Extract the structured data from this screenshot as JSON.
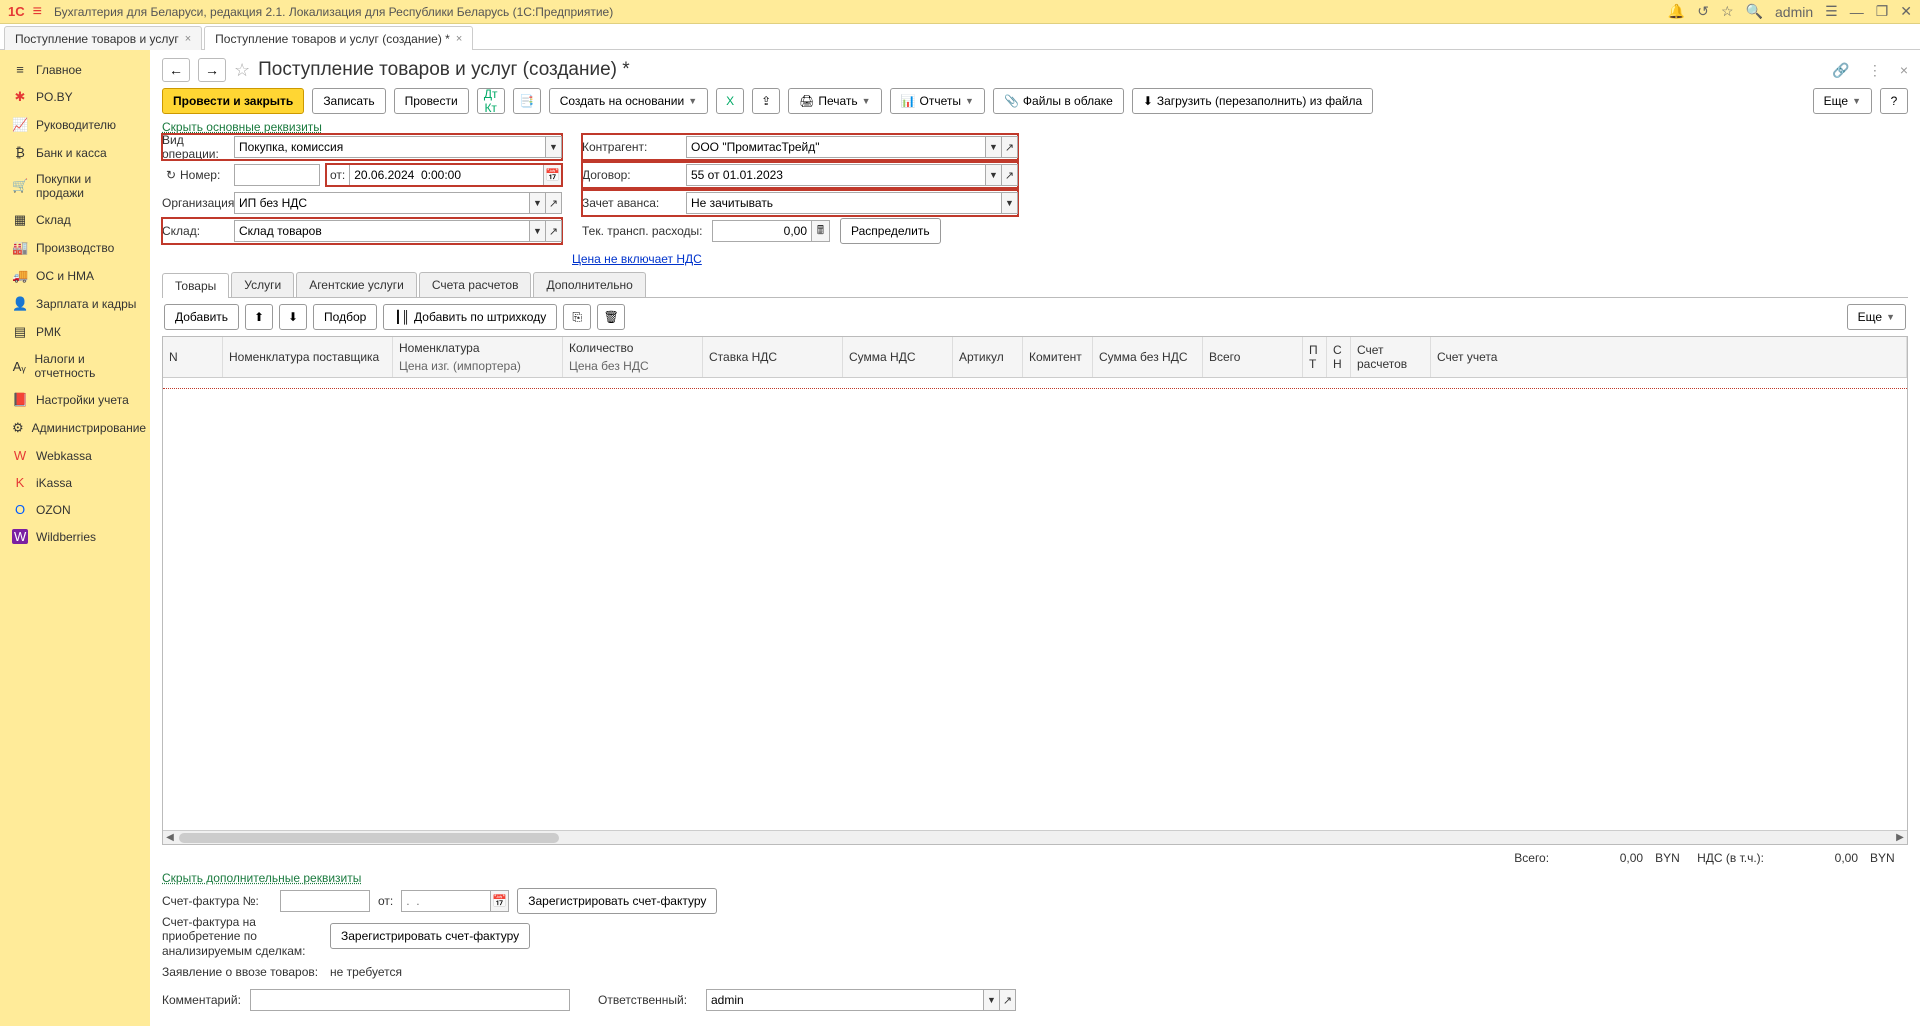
{
  "app": {
    "logo": "1C",
    "title": "Бухгалтерия для Беларуси, редакция 2.1. Локализация для Республики Беларусь   (1С:Предприятие)",
    "user": "admin"
  },
  "tabs": [
    {
      "label": "Поступление товаров и услуг",
      "active": false
    },
    {
      "label": "Поступление товаров и услуг (создание) *",
      "active": true
    }
  ],
  "sidebar": [
    {
      "icon": "≡",
      "label": "Главное"
    },
    {
      "icon": "✱",
      "label": "PO.BY"
    },
    {
      "icon": "📈",
      "label": "Руководителю"
    },
    {
      "icon": "₿",
      "label": "Банк и касса"
    },
    {
      "icon": "🛒",
      "label": "Покупки и продажи"
    },
    {
      "icon": "▦",
      "label": "Склад"
    },
    {
      "icon": "🏭",
      "label": "Производство"
    },
    {
      "icon": "🚚",
      "label": "ОС и НМА"
    },
    {
      "icon": "👤",
      "label": "Зарплата и кадры"
    },
    {
      "icon": "▤",
      "label": "РМК"
    },
    {
      "icon": "Aᵧ",
      "label": "Налоги и отчетность"
    },
    {
      "icon": "📕",
      "label": "Настройки учета"
    },
    {
      "icon": "⚙",
      "label": "Администрирование"
    },
    {
      "icon": "W",
      "label": "Webkassa"
    },
    {
      "icon": "K",
      "label": "iKassa"
    },
    {
      "icon": "O",
      "label": "OZON"
    },
    {
      "icon": "W",
      "label": "Wildberries"
    }
  ],
  "page": {
    "title": "Поступление товаров и услуг (создание) *"
  },
  "toolbar": {
    "post_close": "Провести и закрыть",
    "save": "Записать",
    "post": "Провести",
    "create_based": "Создать на основании",
    "print": "Печать",
    "reports": "Отчеты",
    "files_cloud": "Файлы в облаке",
    "load_file": "Загрузить (перезаполнить) из файла",
    "more": "Еще"
  },
  "links": {
    "hide_main": "Скрыть основные реквизиты",
    "hide_extra": "Скрыть дополнительные реквизиты",
    "vat_note": "Цена не включает НДС"
  },
  "form": {
    "left": {
      "op_type_label": "Вид операции:",
      "op_type_value": "Покупка, комиссия",
      "number_label": "Номер:",
      "number_value": "",
      "from_label": "от:",
      "date_value": "20.06.2024  0:00:00",
      "org_label": "Организация:",
      "org_value": "ИП без НДС",
      "warehouse_label": "Склад:",
      "warehouse_value": "Склад товаров"
    },
    "right": {
      "counterparty_label": "Контрагент:",
      "counterparty_value": "ООО \"ПромитасТрейд\"",
      "contract_label": "Договор:",
      "contract_value": "55 от 01.01.2023",
      "advance_label": "Зачет аванса:",
      "advance_value": "Не зачитывать",
      "transport_label": "Тек. трансп. расходы:",
      "transport_value": "0,00",
      "distribute": "Распределить"
    }
  },
  "tabs2": [
    "Товары",
    "Услуги",
    "Агентские услуги",
    "Счета расчетов",
    "Дополнительно"
  ],
  "tbl_toolbar": {
    "add": "Добавить",
    "pick": "Подбор",
    "add_barcode": "Добавить по штрихкоду",
    "more": "Еще"
  },
  "columns": {
    "n": "N",
    "supplier_nom": "Номенклатура поставщика",
    "nom": "Номенклатура",
    "nom_sub": "Цена изг. (импортера)",
    "qty": "Количество",
    "qty_sub": "Цена без НДС",
    "vat_rate": "Ставка НДС",
    "vat_sum": "Сумма НДС",
    "article": "Артикул",
    "committent": "Комитент",
    "sum_no_vat": "Сумма без НДС",
    "total": "Всего",
    "pt": "П Т",
    "sn": "С Н",
    "acct": "Счет расчетов",
    "acct2": "Счет учета"
  },
  "totals": {
    "total_label": "Всего:",
    "total_value": "0,00",
    "currency": "BYN",
    "vat_label": "НДС (в т.ч.):",
    "vat_value": "0,00"
  },
  "bottom": {
    "invoice_no_label": "Счет-фактура №:",
    "from_label": "от:",
    "date_placeholder": ".  .",
    "reg_invoice": "Зарегистрировать счет-фактуру",
    "invoice_analyzed_label": "Счет-фактура на приобретение по анализируемым сделкам:",
    "reg_invoice2": "Зарегистрировать счет-фактуру",
    "import_decl_label": "Заявление о ввозе товаров:",
    "import_decl_value": "не требуется",
    "comment_label": "Комментарий:",
    "responsible_label": "Ответственный:",
    "responsible_value": "admin"
  }
}
